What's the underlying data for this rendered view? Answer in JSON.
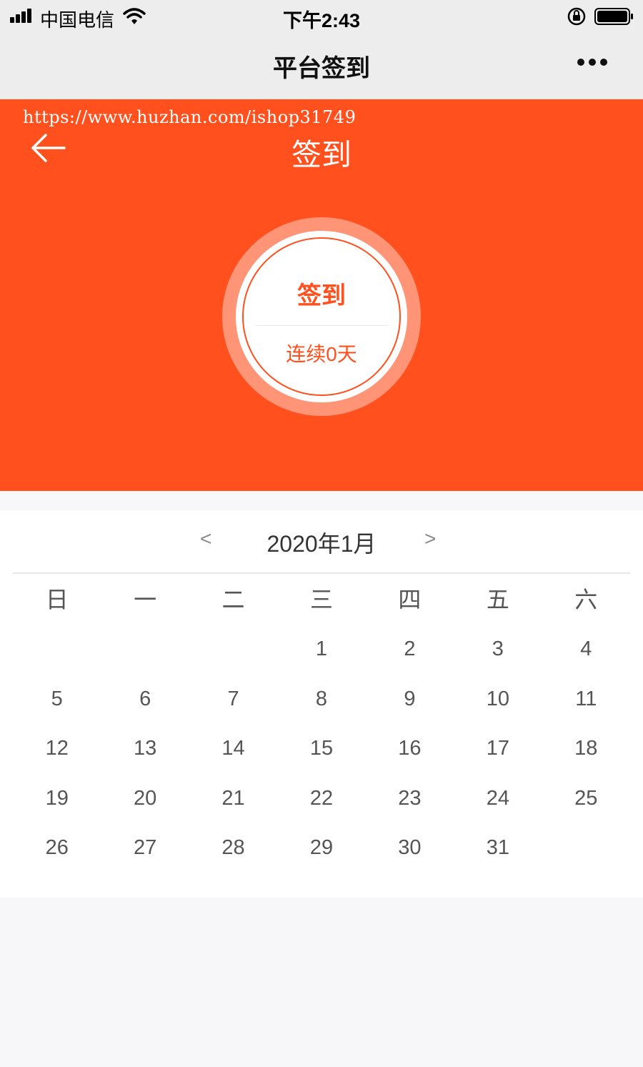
{
  "status_bar": {
    "carrier": "中国电信",
    "time": "下午2:43"
  },
  "nav": {
    "title": "平台签到",
    "more_icon": "more-dots-icon"
  },
  "hero": {
    "watermark": "https://www.huzhan.com/ishop31749",
    "title": "签到",
    "back_icon": "back-arrow-icon",
    "sign_button_label": "签到",
    "streak_text": "连续0天",
    "accent_color": "#ff501e"
  },
  "calendar": {
    "prev_label": "<",
    "next_label": ">",
    "month_label": "2020年1月",
    "weekdays": [
      "日",
      "一",
      "二",
      "三",
      "四",
      "五",
      "六"
    ],
    "leading_blanks": 3,
    "days": [
      "1",
      "2",
      "3",
      "4",
      "5",
      "6",
      "7",
      "8",
      "9",
      "10",
      "11",
      "12",
      "13",
      "14",
      "15",
      "16",
      "17",
      "18",
      "19",
      "20",
      "21",
      "22",
      "23",
      "24",
      "25",
      "26",
      "27",
      "28",
      "29",
      "30",
      "31"
    ]
  }
}
